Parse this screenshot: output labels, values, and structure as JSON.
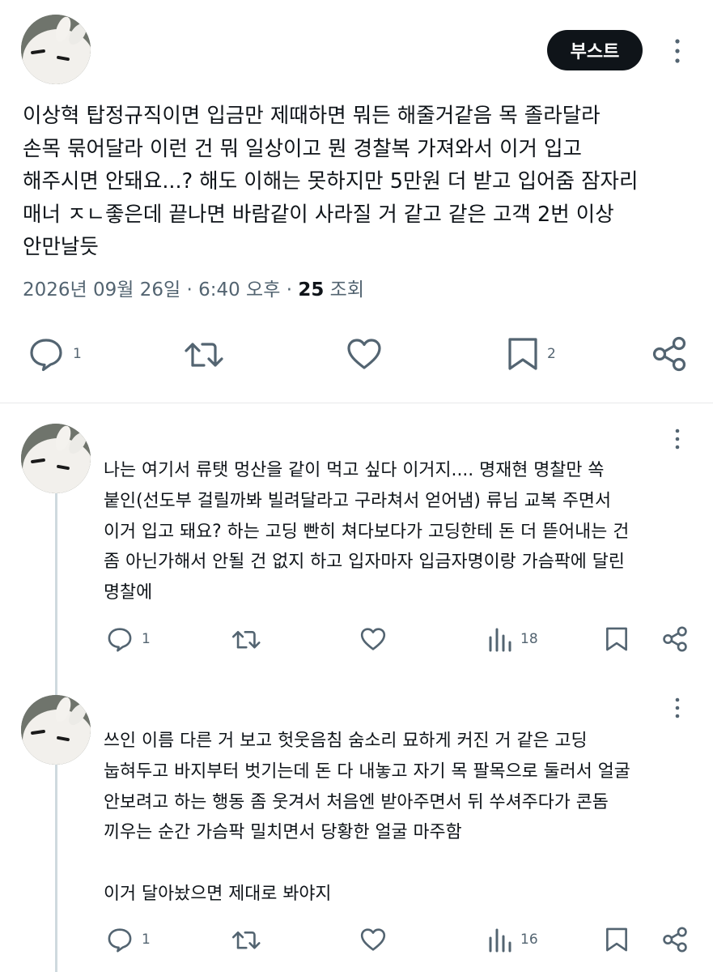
{
  "post": {
    "boost_label": "부스트",
    "text": "이상혁 탑정규직이면 입금만 제때하면 뭐든 해줄거같음 목 졸라달라\n손목 묶어달라 이런 건 뭐 일상이고 뭔 경찰복 가져와서 이거 입고\n해주시면 안돼요...? 해도 이해는 못하지만 5만원 더 받고 입어줌 잠자리\n매너 ㅈㄴ좋은데 끝나면 바람같이 사라질 거 같고 같은 고객 2번 이상\n안만날듯",
    "date": "2026년 09월 26일 · 6:40 오후 · ",
    "views": "25",
    "views_label": " 조회",
    "reply_count": "1",
    "bookmark_count": "2"
  },
  "replies": [
    {
      "text": "나는 여기서 류탯 멍산을 같이 먹고 싶다 이거지.... 명재현 명찰만 쏙\n붙인(선도부 걸릴까봐 빌려달라고 구라쳐서 얻어냄) 류님 교복 주면서\n이거 입고 돼요? 하는 고딩 빤히 쳐다보다가 고딩한테 돈 더 뜯어내는 건\n좀 아닌가해서 안될 건 없지 하고 입자마자 입금자명이랑 가슴팍에 달린\n명찰에",
      "reply_count": "1",
      "views": "18"
    },
    {
      "text": "쓰인 이름 다른 거 보고 헛웃음침 숨소리 묘하게 커진 거 같은 고딩\n눕혀두고 바지부터 벗기는데 돈 다 내놓고 자기 목 팔목으로 둘러서 얼굴\n안보려고 하는 행동 좀 웃겨서 처음엔 받아주면서 뒤 쑤셔주다가 콘돔\n끼우는 순간 가슴팍 밀치면서 당황한 얼굴 마주함\n\n이거 달아놨으면 제대로 봐야지",
      "reply_count": "1",
      "views": "16"
    }
  ],
  "icons": {
    "reply": "speech-bubble-icon",
    "repost": "repost-icon",
    "like": "heart-icon",
    "bookmark": "bookmark-icon",
    "share": "share-icon",
    "views": "bar-chart-icon",
    "more": "more-vertical-icon"
  },
  "colors": {
    "text": "#0f1419",
    "secondary": "#536471",
    "divider": "#e7e9ea",
    "thread_line": "#cfd9de",
    "boost_bg": "#0f1419"
  }
}
